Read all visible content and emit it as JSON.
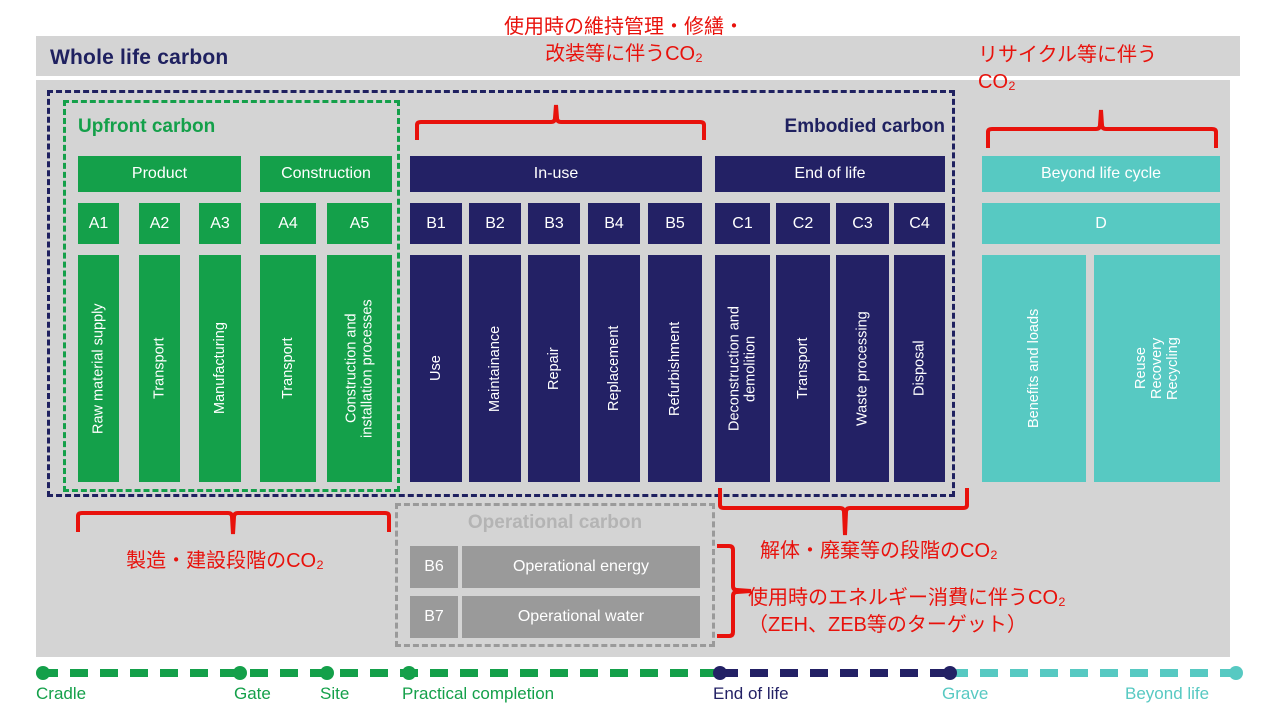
{
  "header": {
    "title": "Whole life carbon"
  },
  "sections": {
    "upfront": "Upfront carbon",
    "embodied": "Embodied carbon",
    "operational": "Operational carbon"
  },
  "stages": {
    "product": {
      "header": "Product",
      "codes": [
        "A1",
        "A2",
        "A3"
      ],
      "labels": [
        "Raw material supply",
        "Transport",
        "Manufacturing"
      ]
    },
    "construction": {
      "header": "Construction",
      "codes": [
        "A4",
        "A5"
      ],
      "labels": [
        "Transport",
        "Construction and\ninstallation processes"
      ]
    },
    "inuse": {
      "header": "In-use",
      "codes": [
        "B1",
        "B2",
        "B3",
        "B4",
        "B5"
      ],
      "labels": [
        "Use",
        "Maintainance",
        "Repair",
        "Replacement",
        "Refurbishment"
      ]
    },
    "endoflife": {
      "header": "End of life",
      "codes": [
        "C1",
        "C2",
        "C3",
        "C4"
      ],
      "labels": [
        "Deconstruction and\ndemolition",
        "Transport",
        "Waste processing",
        "Disposal"
      ]
    },
    "beyond": {
      "header": "Beyond life cycle",
      "codes": [
        "D"
      ],
      "labels": [
        "Benefits and loads",
        "Reuse\nRecovery\nRecycling"
      ]
    },
    "operational": {
      "codes": [
        "B6",
        "B7"
      ],
      "labels": [
        "Operational energy",
        "Operational water"
      ]
    }
  },
  "annotations": {
    "inuse_co2": "使用時の維持管理・修繕・\n改装等に伴うCO₂",
    "recycle_co2": "リサイクル等に伴う\nCO₂",
    "upfront_co2": "製造・建設段階のCO₂",
    "endoflife_co2": "解体・廃棄等の段階のCO₂",
    "operational_co2": "使用時のエネルギー消費に伴うCO₂\n（ZEH、ZEB等のターゲット）"
  },
  "timeline": {
    "points": [
      {
        "label": "Cradle",
        "color": "#14a04a"
      },
      {
        "label": "Gate",
        "color": "#14a04a"
      },
      {
        "label": "Site",
        "color": "#14a04a"
      },
      {
        "label": "Practical completion",
        "color": "#14a04a"
      },
      {
        "label": "End of life",
        "color": "#232165"
      },
      {
        "label": "Grave",
        "color": "#57c9c2"
      },
      {
        "label": "Beyond life",
        "color": "#57c9c2"
      }
    ]
  },
  "colors": {
    "green": "#14a04a",
    "navy": "#232165",
    "teal": "#57c9c2",
    "gray": "#9a9a9a",
    "panel": "#d4d4d4",
    "red": "#e8120c"
  }
}
